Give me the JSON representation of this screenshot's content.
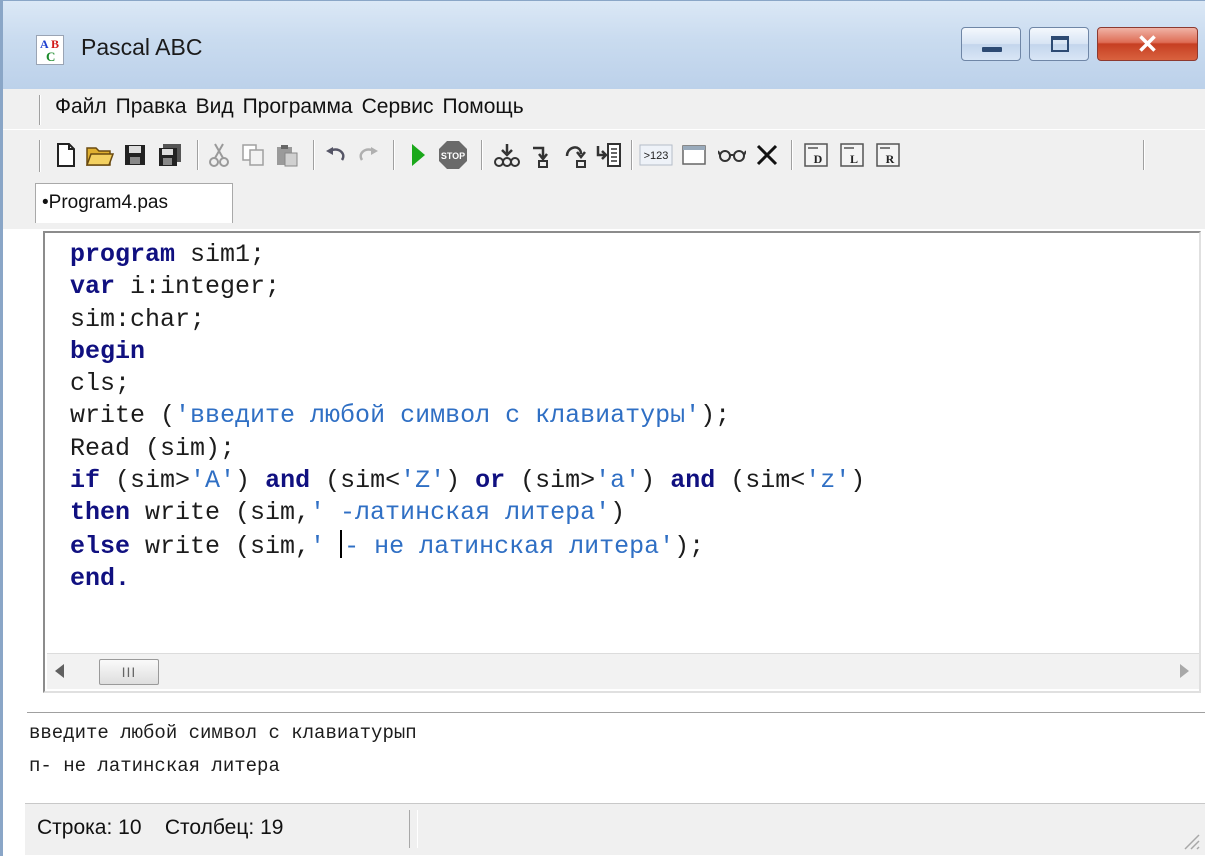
{
  "window": {
    "title": "Pascal ABC",
    "icon_letters": {
      "a": "A",
      "b": "B",
      "c": "C"
    },
    "controls": {
      "minimize": "minimize-icon",
      "maximize": "maximize-icon",
      "close": "✕"
    }
  },
  "menu": {
    "items": [
      "Файл",
      "Правка",
      "Вид",
      "Программа",
      "Сервис",
      "Помощь"
    ]
  },
  "toolbar": {
    "buttons": [
      "new-file-icon",
      "open-folder-icon",
      "save-icon",
      "save-all-icon",
      "cut-icon",
      "copy-icon",
      "paste-icon",
      "undo-icon",
      "redo-icon",
      "run-icon",
      "stop-icon",
      "step-into-icon",
      "step-over-icon",
      "step-out-icon",
      "run-to-cursor-icon",
      "watch-icon",
      "output-window-icon",
      "glasses-icon",
      "delete-icon",
      "debug-d-icon",
      "debug-l-icon",
      "debug-r-icon"
    ],
    "labels": {
      "stop": "STOP",
      "value": ">123",
      "d": "D",
      "l": "L",
      "r": "R"
    }
  },
  "tab": {
    "label": "•Program4.pas"
  },
  "editor": {
    "lines": [
      {
        "tokens": [
          {
            "t": "program",
            "k": "kw"
          },
          {
            "t": " sim1;",
            "k": ""
          }
        ]
      },
      {
        "tokens": [
          {
            "t": "var",
            "k": "kw"
          },
          {
            "t": " i:integer;",
            "k": ""
          }
        ]
      },
      {
        "tokens": [
          {
            "t": "sim:char;",
            "k": ""
          }
        ]
      },
      {
        "tokens": [
          {
            "t": "begin",
            "k": "kw"
          }
        ]
      },
      {
        "tokens": [
          {
            "t": "cls;",
            "k": ""
          }
        ]
      },
      {
        "tokens": [
          {
            "t": "write (",
            "k": ""
          },
          {
            "t": "'введите любой символ с клавиатуры'",
            "k": "str"
          },
          {
            "t": ");",
            "k": ""
          }
        ]
      },
      {
        "tokens": [
          {
            "t": "Read (sim);",
            "k": ""
          }
        ]
      },
      {
        "tokens": [
          {
            "t": "if",
            "k": "kw"
          },
          {
            "t": " (sim>",
            "k": ""
          },
          {
            "t": "'A'",
            "k": "str"
          },
          {
            "t": ") ",
            "k": ""
          },
          {
            "t": "and",
            "k": "kw"
          },
          {
            "t": " (sim<",
            "k": ""
          },
          {
            "t": "'Z'",
            "k": "str"
          },
          {
            "t": ") ",
            "k": ""
          },
          {
            "t": "or",
            "k": "kw"
          },
          {
            "t": " (sim>",
            "k": ""
          },
          {
            "t": "'a'",
            "k": "str"
          },
          {
            "t": ") ",
            "k": ""
          },
          {
            "t": "and",
            "k": "kw"
          },
          {
            "t": " (sim<",
            "k": ""
          },
          {
            "t": "'z'",
            "k": "str"
          },
          {
            "t": ")",
            "k": ""
          }
        ]
      },
      {
        "tokens": [
          {
            "t": "then",
            "k": "kw"
          },
          {
            "t": " write (sim,",
            "k": ""
          },
          {
            "t": "' -латинская литера'",
            "k": "str"
          },
          {
            "t": ")",
            "k": ""
          }
        ]
      },
      {
        "tokens": [
          {
            "t": "else",
            "k": "kw"
          },
          {
            "t": " write (sim,",
            "k": ""
          },
          {
            "t": "' ",
            "k": "str"
          },
          {
            "t": "",
            "k": "caret"
          },
          {
            "t": "- не латинская литера'",
            "k": "str"
          },
          {
            "t": ");",
            "k": ""
          }
        ]
      },
      {
        "tokens": [
          {
            "t": "end.",
            "k": "kw"
          }
        ]
      }
    ],
    "scrollbar_thumb": "III"
  },
  "output": {
    "lines": [
      "введите любой символ с клавиатурып",
      "п- не латинская литера"
    ]
  },
  "status": {
    "line_label": "Строка:",
    "line_value": "10",
    "col_label": "Столбец:",
    "col_value": "19"
  },
  "colors": {
    "keyword": "#101080",
    "string": "#2f6fc4",
    "run": "#1aa81a",
    "stop": "#606060"
  }
}
